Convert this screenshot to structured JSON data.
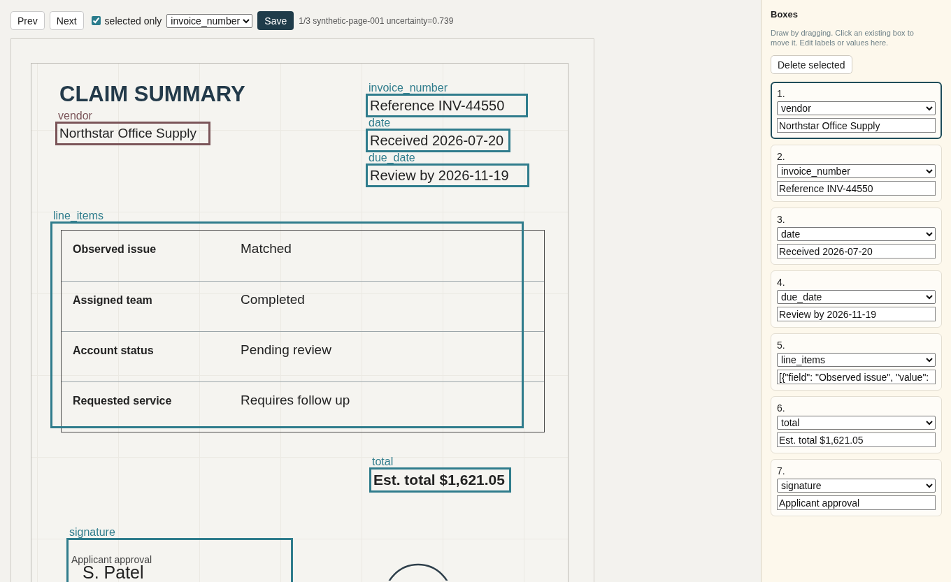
{
  "toolbar": {
    "prev": "Prev",
    "next": "Next",
    "selected_only": {
      "label": "selected only",
      "checked": true
    },
    "field_select": "invoice_number",
    "save": "Save",
    "status": "1/3 synthetic-page-001 uncertainty=0.739"
  },
  "document": {
    "title": "CLAIM SUMMARY",
    "vendor": "Northstar Office Supply",
    "details": [
      "Reference INV-44550",
      "Received 2026-07-20",
      "Review by 2026-11-19"
    ],
    "line_items": [
      {
        "field": "Observed issue",
        "value": "Matched"
      },
      {
        "field": "Assigned team",
        "value": "Completed"
      },
      {
        "field": "Account status",
        "value": "Pending review"
      },
      {
        "field": "Requested service",
        "value": "Requires follow up"
      }
    ],
    "total": "Est. total $1,621.05",
    "signature": {
      "label": "Applicant approval",
      "name": "S. Patel"
    }
  },
  "annotations": [
    {
      "label": "vendor",
      "selected": true
    },
    {
      "label": "invoice_number",
      "selected": false
    },
    {
      "label": "date",
      "selected": false
    },
    {
      "label": "due_date",
      "selected": false
    },
    {
      "label": "line_items",
      "selected": false
    },
    {
      "label": "total",
      "selected": false
    },
    {
      "label": "signature",
      "selected": false
    }
  ],
  "sidebar": {
    "title": "Boxes",
    "hint": "Draw by dragging. Click an existing box to move it. Edit labels or values here.",
    "delete_button": "Delete selected",
    "cards": [
      {
        "number": "1.",
        "field": "vendor",
        "value": "Northstar Office Supply",
        "selected": true
      },
      {
        "number": "2.",
        "field": "invoice_number",
        "value": "Reference INV-44550",
        "selected": false
      },
      {
        "number": "3.",
        "field": "date",
        "value": "Received 2026-07-20",
        "selected": false
      },
      {
        "number": "4.",
        "field": "due_date",
        "value": "Review by 2026-11-19",
        "selected": false
      },
      {
        "number": "5.",
        "field": "line_items",
        "value": "[{\"field\": \"Observed issue\", \"value\":",
        "selected": false
      },
      {
        "number": "6.",
        "field": "total",
        "value": "Est. total $1,621.05",
        "selected": false
      },
      {
        "number": "7.",
        "field": "signature",
        "value": "Applicant approval",
        "selected": false
      }
    ]
  }
}
